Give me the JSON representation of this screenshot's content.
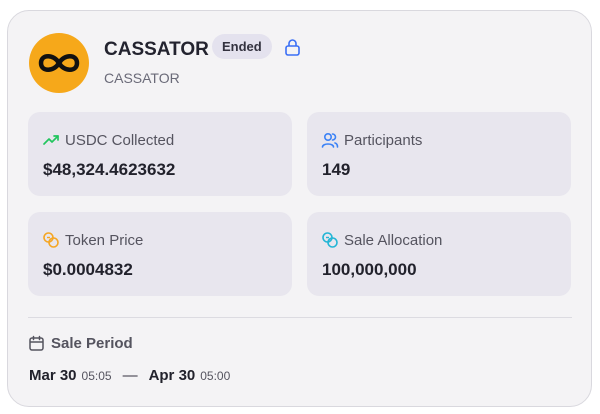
{
  "project": {
    "name": "CASSATOR",
    "symbol": "CASSATOR",
    "status": "Ended",
    "logo_icon": "infinity-logo-icon",
    "logo_color": "#f6a81a"
  },
  "stats": [
    {
      "label": "USDC Collected",
      "value": "$48,324.4623632",
      "icon": "trending-up-icon",
      "icon_color": "#22c55e"
    },
    {
      "label": "Participants",
      "value": "149",
      "icon": "users-icon",
      "icon_color": "#3b82f6"
    },
    {
      "label": "Token Price",
      "value": "$0.0004832",
      "icon": "coins-icon",
      "icon_color": "#f5a623"
    },
    {
      "label": "Sale Allocation",
      "value": "100,000,000",
      "icon": "coins-icon",
      "icon_color": "#22b5d5"
    }
  ],
  "sale_period": {
    "label": "Sale Period",
    "start_date": "Mar 30",
    "start_time": "05:05",
    "separator": "—",
    "end_date": "Apr 30",
    "end_time": "05:00"
  },
  "colors": {
    "lock": "#3b6ff5",
    "badge_bg": "#e4e2ee"
  }
}
